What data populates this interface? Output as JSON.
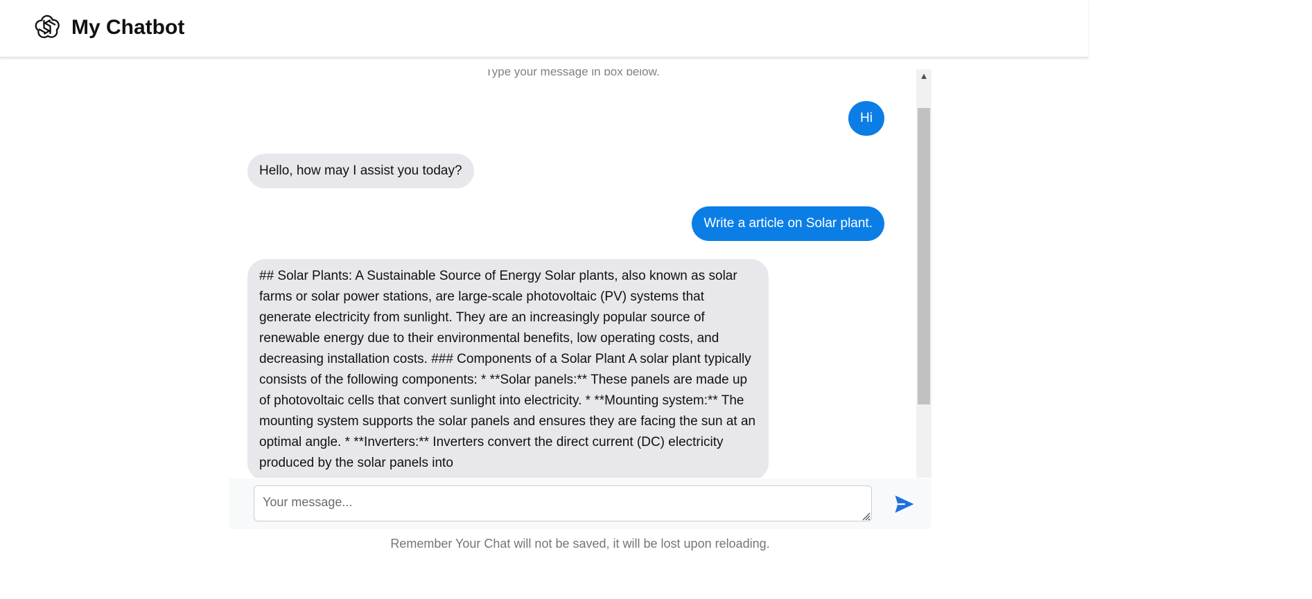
{
  "header": {
    "title": "My Chatbot",
    "logo_icon": "openai-logo-icon"
  },
  "chat": {
    "intro": "Type your message in box below.",
    "messages": [
      {
        "role": "user",
        "text": "Hi"
      },
      {
        "role": "bot",
        "text": "Hello, how may I assist you today?"
      },
      {
        "role": "user",
        "text": "Write a article on Solar plant."
      },
      {
        "role": "bot",
        "text": "## Solar Plants: A Sustainable Source of Energy Solar plants, also known as solar farms or solar power stations, are large-scale photovoltaic (PV) systems that generate electricity from sunlight. They are an increasingly popular source of renewable energy due to their environmental benefits, low operating costs, and decreasing installation costs. ### Components of a Solar Plant A solar plant typically consists of the following components: * **Solar panels:** These panels are made up of photovoltaic cells that convert sunlight into electricity. * **Mounting system:** The mounting system supports the solar panels and ensures they are facing the sun at an optimal angle. * **Inverters:** Inverters convert the direct current (DC) electricity produced by the solar panels into"
      }
    ]
  },
  "input": {
    "placeholder": "Your message...",
    "value": ""
  },
  "send": {
    "icon": "send-icon"
  },
  "footer": {
    "note": "Remember Your Chat will not be saved, it will be lost upon reloading."
  },
  "colors": {
    "user_bubble": "#0b7ee6",
    "bot_bubble": "#e8e8ec",
    "send_icon": "#1f6fe0"
  }
}
